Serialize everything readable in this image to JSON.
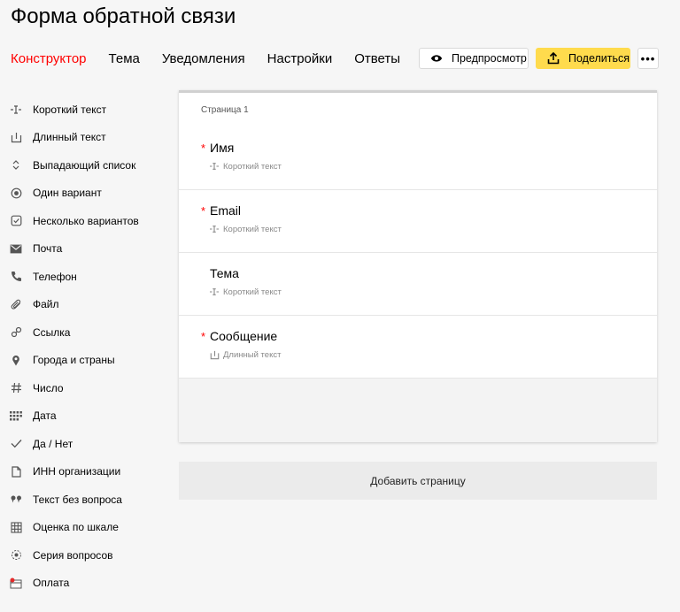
{
  "page": {
    "title": "Форма обратной связи"
  },
  "nav": {
    "tabs": [
      {
        "label": "Конструктор",
        "active": true
      },
      {
        "label": "Тема"
      },
      {
        "label": "Уведомления"
      },
      {
        "label": "Настройки"
      },
      {
        "label": "Ответы"
      }
    ]
  },
  "actions": {
    "preview_label": "Предпросмотр",
    "share_label": "Поделиться",
    "more_label": "•••"
  },
  "sidebar": {
    "items": [
      {
        "label": "Короткий текст",
        "icon": "short-text-icon"
      },
      {
        "label": "Длинный текст",
        "icon": "long-text-icon"
      },
      {
        "label": "Выпадающий список",
        "icon": "dropdown-icon"
      },
      {
        "label": "Один вариант",
        "icon": "radio-icon"
      },
      {
        "label": "Несколько вариантов",
        "icon": "checkbox-icon"
      },
      {
        "label": "Почта",
        "icon": "mail-icon"
      },
      {
        "label": "Телефон",
        "icon": "phone-icon"
      },
      {
        "label": "Файл",
        "icon": "paperclip-icon"
      },
      {
        "label": "Ссылка",
        "icon": "link-icon"
      },
      {
        "label": "Города и страны",
        "icon": "location-pin-icon"
      },
      {
        "label": "Число",
        "icon": "hash-icon"
      },
      {
        "label": "Дата",
        "icon": "calendar-icon"
      },
      {
        "label": "Да / Нет",
        "icon": "check-icon"
      },
      {
        "label": "ИНН организации",
        "icon": "document-icon"
      },
      {
        "label": "Текст без вопроса",
        "icon": "quote-icon"
      },
      {
        "label": "Оценка по шкале",
        "icon": "scale-grid-icon"
      },
      {
        "label": "Серия вопросов",
        "icon": "series-icon"
      },
      {
        "label": "Оплата",
        "icon": "payment-icon"
      }
    ]
  },
  "form": {
    "page_label": "Страница 1",
    "questions": [
      {
        "title": "Имя",
        "required": "*",
        "type": "Короткий текст"
      },
      {
        "title": "Email",
        "required": "*",
        "type": "Короткий текст"
      },
      {
        "title": "Тема",
        "required": "",
        "type": "Короткий текст"
      },
      {
        "title": "Сообщение",
        "required": "*",
        "type": "Длинный текст"
      }
    ],
    "add_page_label": "Добавить страницу"
  },
  "colors": {
    "active_tab": "#ff0000",
    "required_star": "#ff0000",
    "share_button": "#ffdb4d"
  }
}
